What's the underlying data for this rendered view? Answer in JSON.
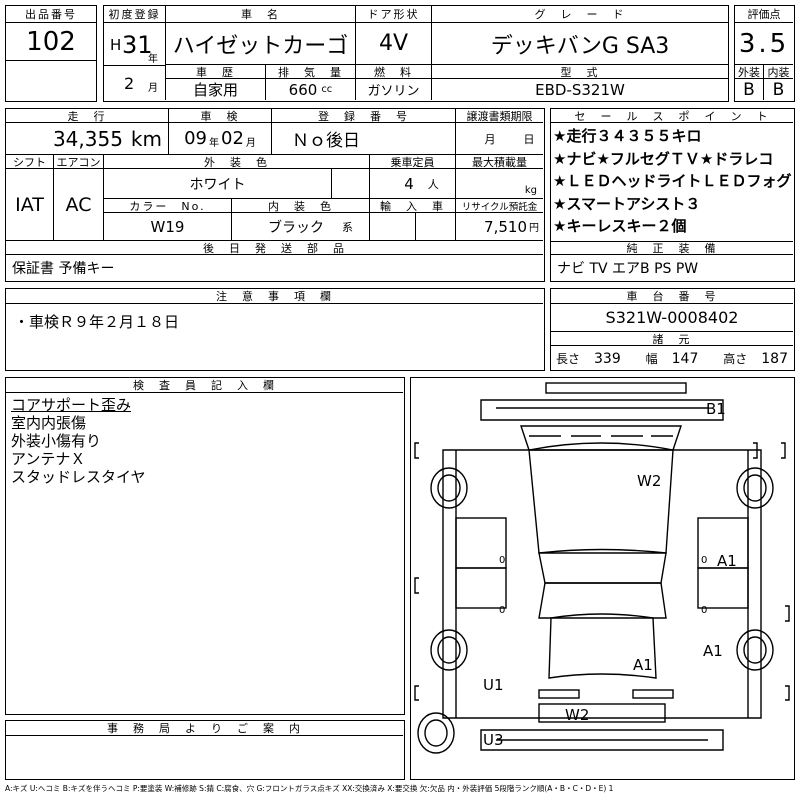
{
  "header": {
    "lot_label": "出品番号",
    "lot_no": "102",
    "reg_label": "初度登録",
    "era": "H",
    "year": "31",
    "year_unit": "年",
    "month": "2",
    "month_unit": "月",
    "name_label": "車　名",
    "name": "ハイゼットカーゴ",
    "door_label": "ドア形状",
    "door": "4V",
    "grade_label": "グ　レ　ー　ド",
    "grade": "デッキバンG SA3",
    "score_label": "評価点",
    "score": "3.5",
    "hist_label": "車　歴",
    "hist": "自家用",
    "disp_label": "排　気　量",
    "disp": "660",
    "disp_unit": "cc",
    "fuel_label": "燃　料",
    "fuel": "ガソリン",
    "model_label": "型　式",
    "model": "EBD-S321W",
    "ext_label": "外装",
    "ext": "B",
    "int_label": "内装",
    "int": "B"
  },
  "spec": {
    "mileage_label": "走　行",
    "mileage": "34,355",
    "mileage_unit": "km",
    "inspect_label": "車　検",
    "inspect_y": "09",
    "inspect_yu": "年",
    "inspect_m": "02",
    "inspect_mu": "月",
    "regno_label": "登　録　番　号",
    "regno": "Ｎｏ後日",
    "transfer_label": "譲渡書類期限",
    "transfer_m": "月",
    "transfer_d": "日",
    "shift_label": "シフト",
    "shift": "IAT",
    "ac_label": "エアコン",
    "ac": "AC",
    "color_label": "外　装　色",
    "color": "ホワイト",
    "seats_label": "乗車定員",
    "seats": "4",
    "seats_unit": "人",
    "load_label": "最大積載量",
    "load_unit": "kg",
    "code_label": "カラー　No.",
    "code": "W19",
    "intcolor_label": "内　装　色",
    "intcolor": "ブラック",
    "intcolor_unit": "系",
    "import_label": "輸　入　車",
    "recycle_label": "リサイクル預託金",
    "recycle": "7,510",
    "recycle_unit": "円",
    "later_label": "後　日　発　送　部　品",
    "later": "保証書 予備キー"
  },
  "sales": {
    "label": "セ　ー　ル　ス　ポ　イ　ン　ト",
    "points": [
      "★走行３４３５５キロ",
      "★ナビ★フルセグＴＶ★ドラレコ",
      "★ＬＥＤヘッドライトＬＥＤフォグ",
      "★スマートアシスト３",
      "★キーレスキー２個"
    ],
    "equip_label": "純　正　装　備",
    "equip": "ナビ TV エアB PS PW"
  },
  "notes": {
    "label": "注　意　事　項　欄",
    "text": "・車検Ｒ９年２月１８日"
  },
  "chassis": {
    "label": "車　台　番　号",
    "value": "S321W-0008402",
    "dims_label": "諸　元",
    "len_label": "長さ",
    "len": "339",
    "wid_label": "幅",
    "wid": "147",
    "hei_label": "高さ",
    "hei": "187"
  },
  "inspector": {
    "label": "検　査　員　記　入　欄",
    "lines": [
      "コアサポート歪み",
      "室内内張傷",
      "外装小傷有り",
      "アンテナＸ",
      "スタッドレスタイヤ"
    ]
  },
  "office": {
    "label": "事　務　局　よ　り　ご　案　内"
  },
  "diagram": {
    "marks": [
      "B1",
      "W2",
      "A1",
      "A1",
      "A1",
      "U1",
      "W2",
      "U3"
    ]
  },
  "legend": "A:キズ U:ヘコミ B:キズを伴うヘコミ P:要塗装 W:補修跡 S:錆 C:腐食、穴 G:フロントガラス点キズ XX:交換済み X:要交換 欠:欠品 内・外装評価 5段階ランク順(A・B・C・D・E) 1"
}
